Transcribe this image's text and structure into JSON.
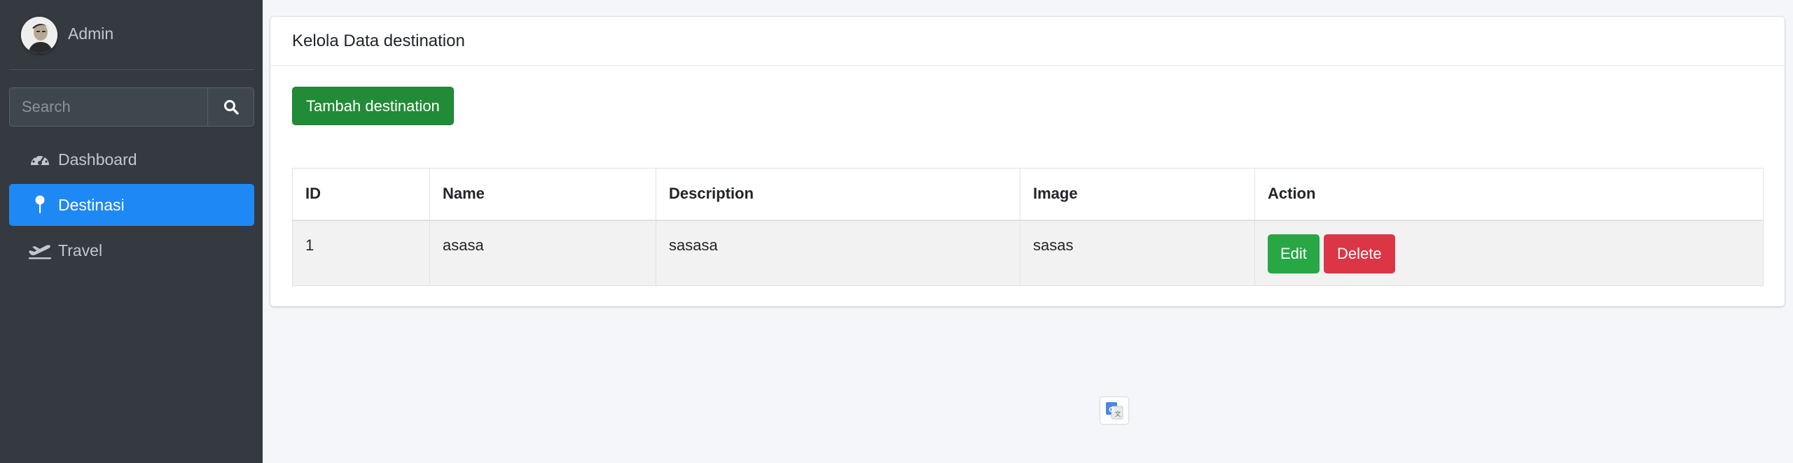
{
  "sidebar": {
    "user": {
      "name": "Admin"
    },
    "search": {
      "placeholder": "Search"
    },
    "items": [
      {
        "label": "Dashboard",
        "icon": "tachometer-icon",
        "active": false
      },
      {
        "label": "Destinasi",
        "icon": "map-pin-icon",
        "active": true
      },
      {
        "label": "Travel",
        "icon": "plane-departure-icon",
        "active": false
      }
    ]
  },
  "main": {
    "title": "Kelola Data destination",
    "add_button": "Tambah destination",
    "table": {
      "headers": [
        "ID",
        "Name",
        "Description",
        "Image",
        "Action"
      ],
      "rows": [
        {
          "id": "1",
          "name": "asasa",
          "description": "sasasa",
          "image": "sasas"
        }
      ],
      "edit_label": "Edit",
      "delete_label": "Delete"
    }
  },
  "colors": {
    "sidebar_bg": "#343a40",
    "active_item": "#1e88f5",
    "success": "#28a745",
    "danger": "#dc3545"
  }
}
